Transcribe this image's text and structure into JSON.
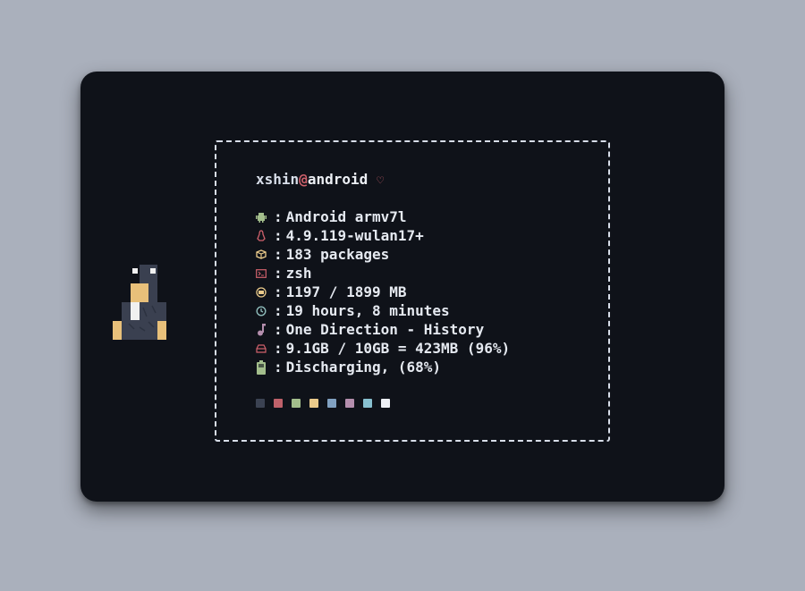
{
  "fetch": {
    "user": "xshin",
    "at": "@",
    "host": "android",
    "heart": "♡",
    "separator": ":",
    "rows": [
      {
        "icon": "android-icon",
        "color": "#a3be8c",
        "value": "Android armv7l"
      },
      {
        "icon": "linux-icon",
        "color": "#d0616c",
        "value": "4.9.119-wulan17+"
      },
      {
        "icon": "package-icon",
        "color": "#ebcb8b",
        "value": "183 packages"
      },
      {
        "icon": "terminal-icon",
        "color": "#d0616c",
        "value": "zsh"
      },
      {
        "icon": "memory-icon",
        "color": "#ebcb8b",
        "value": "1197 / 1899 MB"
      },
      {
        "icon": "clock-icon",
        "color": "#8fbcbb",
        "value": "19 hours, 8 minutes"
      },
      {
        "icon": "music-note-icon",
        "color": "#b48ead",
        "value": "One Direction - History"
      },
      {
        "icon": "disk-icon",
        "color": "#d0616c",
        "value": "9.1GB / 10GB = 423MB (96%)"
      },
      {
        "icon": "battery-icon",
        "color": "#a3be8c",
        "value": "Discharging, (68%)"
      }
    ],
    "palette": [
      "#3b4252",
      "#bf616a",
      "#a3be8c",
      "#ebcb8b",
      "#81a1c1",
      "#b48ead",
      "#88c0d0",
      "#eceff4"
    ]
  }
}
